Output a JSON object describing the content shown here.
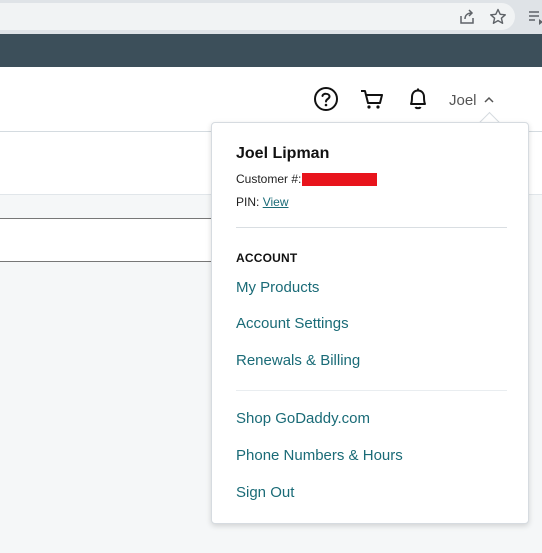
{
  "header": {
    "user_name": "Joel"
  },
  "dropdown": {
    "full_name": "Joel Lipman",
    "customer_label": "Customer #:",
    "pin_label": "PIN:",
    "pin_link": "View",
    "section_title": "ACCOUNT",
    "account_links": [
      "My Products",
      "Account Settings",
      "Renewals & Billing"
    ],
    "other_links": [
      "Shop GoDaddy.com",
      "Phone Numbers & Hours",
      "Sign Out"
    ]
  },
  "colors": {
    "link": "#1a6b77",
    "redaction": "#e8141c",
    "chrome_dark": "#3c4f5a"
  },
  "icons": [
    "share-icon",
    "star-icon",
    "reading-list-icon",
    "help-icon",
    "cart-icon",
    "bell-icon",
    "chevron-up-icon"
  ]
}
